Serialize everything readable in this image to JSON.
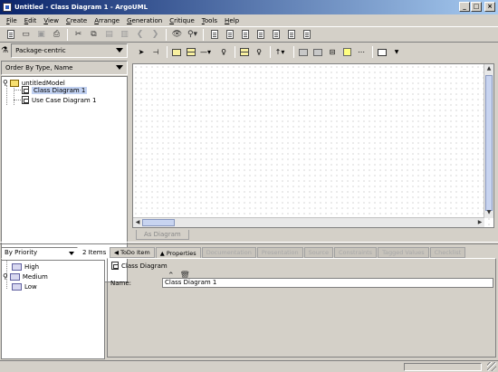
{
  "window": {
    "title": "Untitled - Class Diagram 1 - ArgoUML"
  },
  "menu": [
    {
      "first": "F",
      "rest": "ile"
    },
    {
      "first": "E",
      "rest": "dit"
    },
    {
      "first": "V",
      "rest": "iew"
    },
    {
      "first": "C",
      "rest": "reate"
    },
    {
      "first": "A",
      "rest": "rrange"
    },
    {
      "first": "G",
      "rest": "eneration"
    },
    {
      "first": "C",
      "rest": "ritique"
    },
    {
      "first": "T",
      "rest": "ools"
    },
    {
      "first": "H",
      "rest": "elp"
    }
  ],
  "explorer": {
    "perspective": "Package-centric",
    "order": "Order By Type, Name",
    "tree": {
      "root": "untitledModel",
      "children": [
        "Class Diagram 1",
        "Use Case Diagram 1"
      ]
    }
  },
  "diagram": {
    "tab_label": "As Diagram"
  },
  "todo": {
    "priority": "By Priority",
    "count": "2 Items",
    "groups": [
      "High",
      "Medium",
      "Low"
    ]
  },
  "details": {
    "tabs": [
      "ToDo Item",
      "Properties",
      "Documentation",
      "Presentation",
      "Source",
      "Constraints",
      "Tagged Values",
      "Checklist"
    ],
    "active_tab": "Properties",
    "element_title": "Class Diagram",
    "name_label": "Name:",
    "name_value": "Class Diagram 1"
  }
}
